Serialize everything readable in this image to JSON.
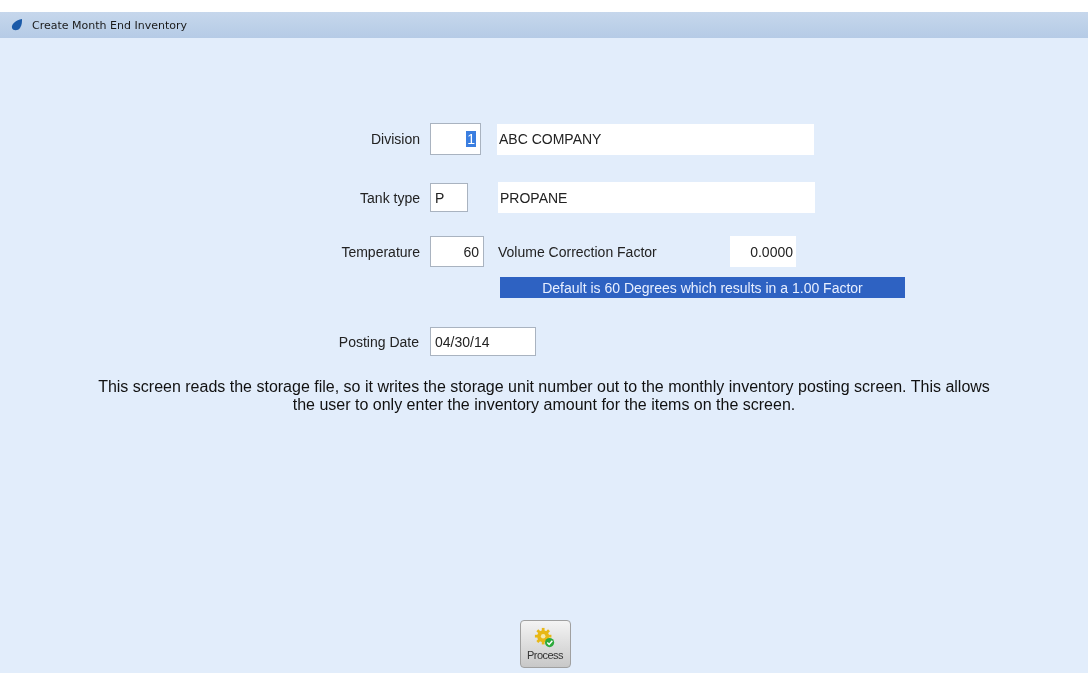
{
  "window": {
    "title": "Create Month End Inventory"
  },
  "fields": [
    {
      "kind": "number_code",
      "label": "Division",
      "value": "1",
      "value_selected": true,
      "description": "ABC COMPANY"
    },
    {
      "kind": "letter_code",
      "label": "Tank type",
      "value": "P",
      "value_selected": false,
      "description": "PROPANE"
    },
    {
      "kind": "temperature",
      "label": "Temperature",
      "value": "60",
      "value_selected": false,
      "factor_label": "Volume Correction Factor",
      "factor_value": "0.0000",
      "note": "Default is 60 Degrees which results in a 1.00 Factor"
    },
    {
      "kind": "date",
      "label": "Posting Date",
      "value": "04/30/14",
      "value_selected": false
    }
  ],
  "description": "This screen reads the storage file, so it writes the storage unit number out to the monthly inventory posting screen. This allows the user to only enter the inventory amount for the items on the screen.",
  "buttons": [
    {
      "label": "Process"
    }
  ]
}
